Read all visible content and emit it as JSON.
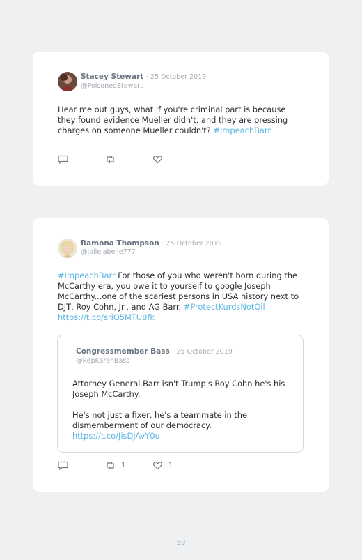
{
  "tweets": [
    {
      "author": "Stacey Stewart",
      "date": "· 25 October 2019",
      "handle": "@PoisonedStewart",
      "text": "Hear me out guys, what if you're criminal part is because they found evidence Mueller didn't, and they are pressing charges on someone Mueller couldn't? ",
      "hashtag": "#ImpeachBarr",
      "counts": {
        "replies": "",
        "retweets": "",
        "likes": ""
      }
    },
    {
      "author": "Ramona Thompson",
      "date": "· 25 October 2019",
      "handle": "@jolielabelle777",
      "hashtag_lead": "#ImpeachBarr",
      "text": " For those of you who weren't born during the McCarthy era, you owe it to yourself to google Joseph McCarthy...one of the scariest persons in USA history next to DJT, Roy Cohn, Jr., and AG Barr. ",
      "hashtag_tail": "#ProtectKurdsNotOil",
      "url": "https://t.co/sriO5MTU8fk",
      "quoted": {
        "author": "Congressmember Bass",
        "date": "· 25 October 2019",
        "handle": "@RepKarenBass",
        "paragraph1": "Attorney General Barr isn't Trump's Roy Cohn he's his Joseph McCarthy.",
        "paragraph2": "He's not just a fixer, he's a teammate in the dismemberment of our democracy.",
        "url": "https://t.co/JisDJAvY0u"
      },
      "counts": {
        "replies": "",
        "retweets": "1",
        "likes": "1"
      }
    }
  ],
  "icons": {
    "reply": "reply-icon",
    "retweet": "retweet-icon",
    "like": "heart-icon"
  },
  "colors": {
    "background": "#eef0f2",
    "card": "#ffffff",
    "link": "#5bb6e6",
    "name": "#6a7480",
    "muted": "#a4acb4"
  },
  "page_number": "59"
}
